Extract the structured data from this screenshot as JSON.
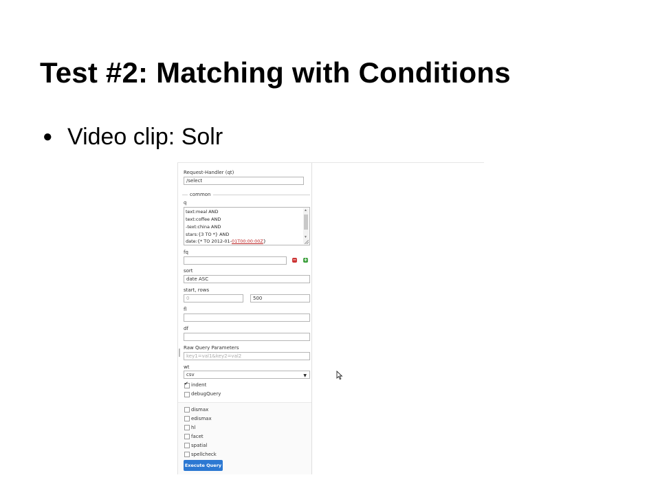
{
  "slide": {
    "title": "Test #2: Matching with Conditions",
    "bullet": "Video clip: Solr"
  },
  "solr": {
    "request_handler_label": "Request-Handler (qt)",
    "request_handler_value": "/select",
    "common_legend": "common",
    "q_label": "q",
    "q_lines": [
      "text:meal AND",
      "text:coffee AND",
      "-text:china AND",
      "stars:{3 TO *} AND"
    ],
    "q_last_line_prefix": "date:{* TO 2012-01-",
    "q_last_line_suffix": "01T00:00:00Z",
    "q_last_line_end": "}",
    "fq_label": "fq",
    "fq_remove": "−",
    "fq_add": "+",
    "sort_label": "sort",
    "sort_value": "date ASC",
    "start_rows_label": "start, rows",
    "start_placeholder": "0",
    "rows_value": "500",
    "fl_label": "fl",
    "df_label": "df",
    "raw_params_label": "Raw Query Parameters",
    "raw_params_placeholder": "key1=val1&key2=val2",
    "wt_label": "wt",
    "wt_value": "csv",
    "wt_arrow": "▼",
    "indent_label": "indent",
    "indent_checked": true,
    "debug_label": "debugQuery",
    "check_mark": "✔",
    "options": [
      "dismax",
      "edismax",
      "hl",
      "facet",
      "spatial",
      "spellcheck"
    ],
    "execute_label": "Execute Query",
    "accent_color": "#2c78d2"
  }
}
